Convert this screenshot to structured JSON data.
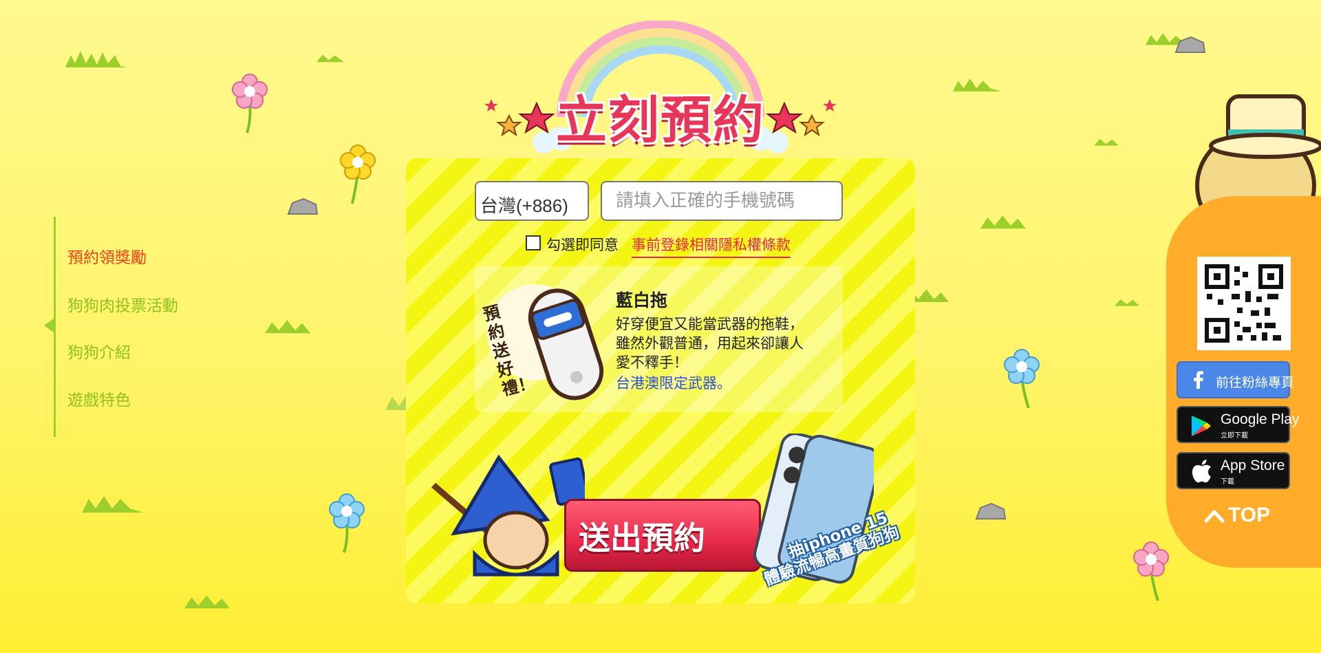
{
  "side_nav": {
    "items": [
      {
        "label": "預約領獎勵",
        "active": true
      },
      {
        "label": "狗狗肉投票活動",
        "active": false
      },
      {
        "label": "狗狗介紹",
        "active": false
      },
      {
        "label": "遊戲特色",
        "active": false
      }
    ]
  },
  "title": "立刻預約",
  "form": {
    "country_code": "台灣(+886)",
    "phone_placeholder": "請填入正確的手機號碼",
    "agree_text": "勾選即同意",
    "privacy_link": "事前登錄相關隱私權條款"
  },
  "gift": {
    "badge_text": "預約送好禮！",
    "name": "藍白拖",
    "desc_line1": "好穿便宜又能當武器的拖鞋，",
    "desc_line2": "雖然外觀普通，用起來卻讓人",
    "desc_line3": "愛不釋手！",
    "note": "台港澳限定武器。"
  },
  "submit": {
    "label": "送出預約",
    "promo_line1": "抽iphone 15",
    "promo_line2": "體驗流暢高畫質狗狗"
  },
  "right_sidebar": {
    "fb_label": "前往粉絲專頁",
    "gplay_big": "Google Play",
    "gplay_small": "立即下載",
    "appstore_big": "App Store",
    "appstore_small": "下載",
    "top_label": "TOP"
  },
  "colors": {
    "accent_red": "#e8284a",
    "nav_green": "#8dc21f",
    "sidebar_orange": "#ffac2a",
    "facebook_blue": "#4a87e8"
  },
  "icons": [
    "facebook-icon",
    "google-play-icon",
    "apple-icon",
    "chevron-up-icon",
    "qr-code-icon",
    "checkbox-icon"
  ]
}
